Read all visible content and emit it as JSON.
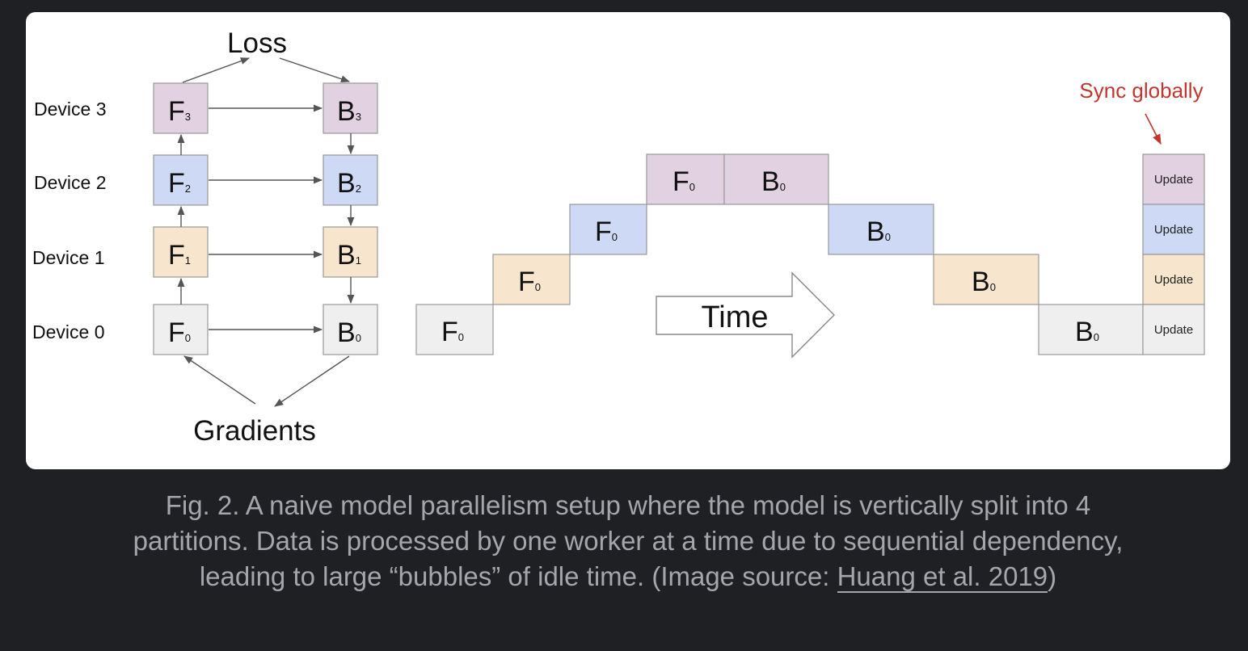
{
  "diagram": {
    "loss_label": "Loss",
    "gradients_label": "Gradients",
    "time_label": "Time",
    "sync_label": "Sync globally",
    "update_label": "Update",
    "devices": [
      {
        "name": "Device 0",
        "fwd": "F",
        "fwd_sub": "0",
        "bwd": "B",
        "bwd_sub": "0",
        "color": "#efefef"
      },
      {
        "name": "Device 1",
        "fwd": "F",
        "fwd_sub": "1",
        "bwd": "B",
        "bwd_sub": "1",
        "color": "#f8e5cd"
      },
      {
        "name": "Device 2",
        "fwd": "F",
        "fwd_sub": "2",
        "bwd": "B",
        "bwd_sub": "2",
        "color": "#cdd9f5"
      },
      {
        "name": "Device 3",
        "fwd": "F",
        "fwd_sub": "3",
        "bwd": "B",
        "bwd_sub": "3",
        "color": "#e2d2e1"
      }
    ],
    "timeline_forward": {
      "label": "F",
      "sub": "0"
    },
    "timeline_backward": {
      "label": "B",
      "sub": "0"
    },
    "colors": {
      "sync": "#c1372e",
      "stroke": "#999999",
      "arrow": "#555555"
    }
  },
  "caption": {
    "text": "Fig. 2. A naive model parallelism setup where the model is vertically split into 4 partitions. Data is processed by one worker at a time due to sequential dependency, leading to large “bubbles” of idle time. (Image source: ",
    "link": "Huang et al. 2019",
    "suffix": ")"
  }
}
